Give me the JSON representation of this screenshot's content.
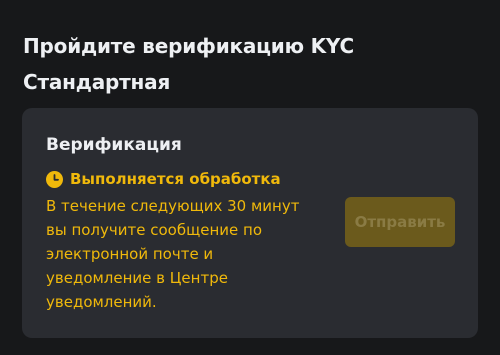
{
  "header": {
    "title_line1": "Пройдите верификацию KYC",
    "title_line2": "Стандартная"
  },
  "card": {
    "title": "Верификация",
    "status": {
      "icon": "clock-icon",
      "text": "Выполняется обработка"
    },
    "description_lines": [
      "В течение следующих 30 минут",
      "вы получите сообщение по",
      "электронной почте и",
      "уведомление в Центре",
      "уведомлений."
    ],
    "button": {
      "label": "Отправить",
      "disabled": true
    }
  },
  "colors": {
    "background": "#17181a",
    "card": "#2a2c31",
    "accent": "#f0b90b",
    "button_disabled_bg": "#6b5a1c",
    "button_disabled_text": "#8a7b44",
    "text_primary": "#eef0f3"
  }
}
